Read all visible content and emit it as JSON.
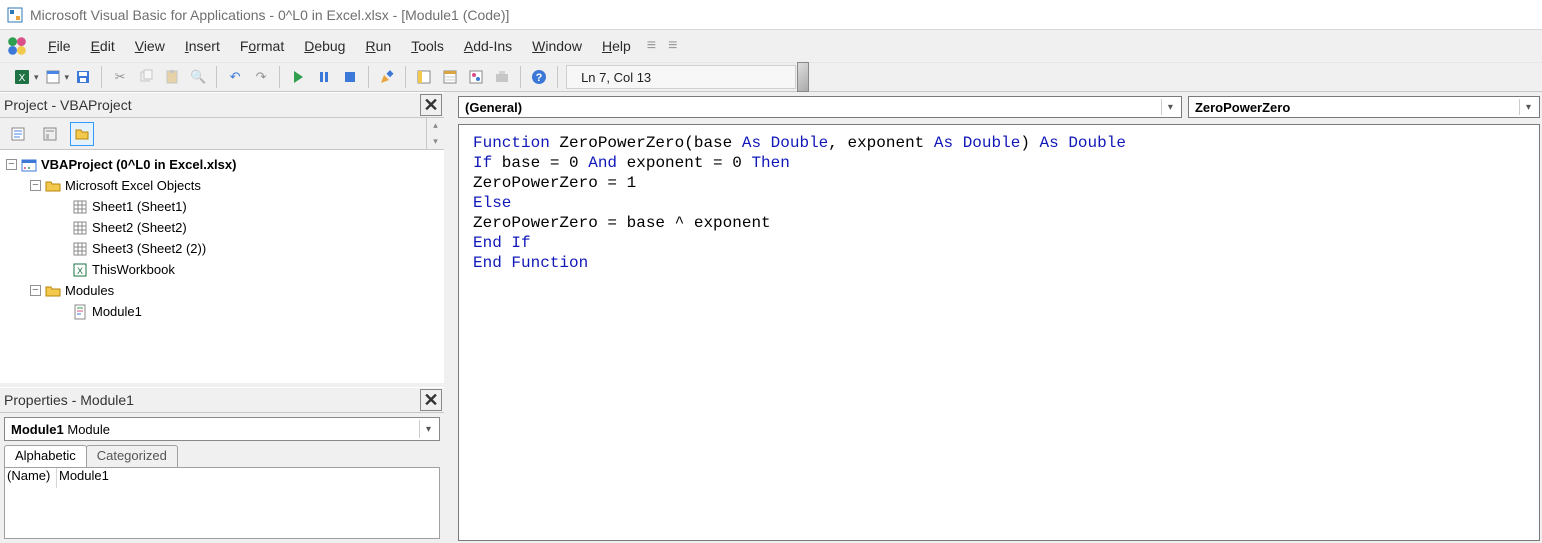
{
  "title": "Microsoft Visual Basic for Applications - 0^L0 in Excel.xlsx - [Module1 (Code)]",
  "menu": {
    "file": "File",
    "edit": "Edit",
    "view": "View",
    "insert": "Insert",
    "format": "Format",
    "debug": "Debug",
    "run": "Run",
    "tools": "Tools",
    "addins": "Add-Ins",
    "window": "Window",
    "help": "Help"
  },
  "status": "Ln 7, Col 13",
  "project": {
    "title": "Project - VBAProject",
    "root": "VBAProject (0^L0 in Excel.xlsx)",
    "msobjects": "Microsoft Excel Objects",
    "sheet1": "Sheet1 (Sheet1)",
    "sheet2": "Sheet2 (Sheet2)",
    "sheet3": "Sheet3 (Sheet2 (2))",
    "thiswb": "ThisWorkbook",
    "modules": "Modules",
    "module1": "Module1"
  },
  "properties": {
    "title": "Properties - Module1",
    "combo_name": "Module1",
    "combo_type": "Module",
    "tab_alpha": "Alphabetic",
    "tab_cat": "Categorized",
    "name_label": "(Name)",
    "name_value": "Module1"
  },
  "code_dd": {
    "left": "(General)",
    "right": "ZeroPowerZero"
  },
  "code": {
    "l1a": "Function",
    "l1b": " ZeroPowerZero(base ",
    "l1c": "As",
    "l1d": " ",
    "l1e": "Double",
    "l1f": ", exponent ",
    "l1g": "As",
    "l1h": " ",
    "l1i": "Double",
    "l1j": ") ",
    "l1k": "As",
    "l1l": " ",
    "l1m": "Double",
    "l2a": "If",
    "l2b": " base = 0 ",
    "l2c": "And",
    "l2d": " exponent = 0 ",
    "l2e": "Then",
    "l3": "ZeroPowerZero = 1",
    "l4": "Else",
    "l5": "ZeroPowerZero = base ^ exponent",
    "l6a": "End",
    "l6b": " ",
    "l6c": "If",
    "l7a": "End",
    "l7b": " ",
    "l7c": "Function"
  }
}
